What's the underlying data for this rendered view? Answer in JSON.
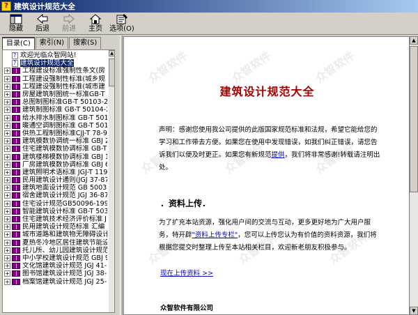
{
  "window": {
    "title": "建筑设计规范大全"
  },
  "toolbar": {
    "buttons": [
      {
        "label": "隐藏",
        "icon": "hide-icon",
        "enabled": true
      },
      {
        "label": "后退",
        "icon": "back-arrow-icon",
        "enabled": true
      },
      {
        "label": "前进",
        "icon": "forward-arrow-icon",
        "enabled": false
      },
      {
        "label": "主页",
        "icon": "home-icon",
        "enabled": true
      },
      {
        "label": "选项(O)",
        "icon": "options-icon",
        "enabled": true
      }
    ]
  },
  "tabs": [
    {
      "label": "目录(C)",
      "active": true
    },
    {
      "label": "索引(N)",
      "active": false
    },
    {
      "label": "搜索(S)",
      "active": false
    }
  ],
  "tree": {
    "items": [
      {
        "label": "欢迎光临众智网站!",
        "type": "page",
        "expander": "",
        "selected": false
      },
      {
        "label": "建筑设计规范大全",
        "type": "page",
        "expander": "",
        "selected": true
      },
      {
        "label": "工程建设标准强制性条文(房",
        "type": "book",
        "expander": "+",
        "selected": false
      },
      {
        "label": "工程建设强制性标准(城乡规",
        "type": "book",
        "expander": "+",
        "selected": false
      },
      {
        "label": "工程建设强制性标准(城市建",
        "type": "book",
        "expander": "+",
        "selected": false
      },
      {
        "label": "房屋建筑制图统一标准GB-T 5",
        "type": "book",
        "expander": "+",
        "selected": false
      },
      {
        "label": "总图制图标准GB-T 50103-200",
        "type": "book",
        "expander": "+",
        "selected": false
      },
      {
        "label": "建筑制图标准 GB-T 50104-200",
        "type": "book",
        "expander": "+",
        "selected": false
      },
      {
        "label": "给水排水制图标准 GB-T 50106",
        "type": "book",
        "expander": "+",
        "selected": false
      },
      {
        "label": "暖通空调制图标准 GB-T 50114",
        "type": "book",
        "expander": "+",
        "selected": false
      },
      {
        "label": "供热工程制图标准CJJ-T 78-9",
        "type": "book",
        "expander": "+",
        "selected": false
      },
      {
        "label": "建筑模数协调统一标准 GBJ 2",
        "type": "book",
        "expander": "+",
        "selected": false
      },
      {
        "label": "住宅建筑模数协调标准 GB-T",
        "type": "book",
        "expander": "+",
        "selected": false
      },
      {
        "label": "建筑楼梯模数协调标准 GBJ 1",
        "type": "book",
        "expander": "+",
        "selected": false
      },
      {
        "label": "厂房建筑模数协调标准 GBJ 6",
        "type": "book",
        "expander": "+",
        "selected": false
      },
      {
        "label": "建筑照明术语标准 JGJ-T 119-",
        "type": "book",
        "expander": "+",
        "selected": false
      },
      {
        "label": "民用建筑设计通则(JGJ 37-87",
        "type": "book",
        "expander": "+",
        "selected": false
      },
      {
        "label": "建筑地面设计规范 GB 50037-9",
        "type": "book",
        "expander": "+",
        "selected": false
      },
      {
        "label": "宿舍建筑设计规范 JGJ 36-87",
        "type": "book",
        "expander": "+",
        "selected": false
      },
      {
        "label": "住宅设计规范GB50096-1999(2",
        "type": "book",
        "expander": "+",
        "selected": false
      },
      {
        "label": "智能建筑设计标准 GB-T 50314",
        "type": "book",
        "expander": "+",
        "selected": false
      },
      {
        "label": "住宅建筑技术经济评价标准 J",
        "type": "book",
        "expander": "+",
        "selected": false
      },
      {
        "label": "民用建筑设计规范标准 汇编",
        "type": "book",
        "expander": "+",
        "selected": false
      },
      {
        "label": "城市道路和建筑物无障碍设计",
        "type": "book",
        "expander": "+",
        "selected": false
      },
      {
        "label": "夏热冬冷地区居住建筑节能设",
        "type": "book",
        "expander": "+",
        "selected": false
      },
      {
        "label": "托儿所、幼儿园建筑设计规范",
        "type": "book",
        "expander": "+",
        "selected": false
      },
      {
        "label": "中小学校建筑设计规范 GBJ 99",
        "type": "book",
        "expander": "+",
        "selected": false
      },
      {
        "label": "文化馆建筑设计规范 JGJ 41-",
        "type": "book",
        "expander": "+",
        "selected": false
      },
      {
        "label": "图书馆建筑设计规范 JGJ 38-9",
        "type": "book",
        "expander": "+",
        "selected": false
      },
      {
        "label": "档案馆建筑设计规范 JGJ 25-",
        "type": "book",
        "expander": "+",
        "selected": false
      }
    ]
  },
  "document": {
    "title": "建筑设计规范大全",
    "statement": {
      "text_before": "声明：感谢您使用我公司提供的此版国家规范标准和法规，希望它能给您的学习和工作带去方便。如果您在使用中发现错误，如我们纠正错误，请您告诉我们以便及时更正。如果您有新规范",
      "link": "提供",
      "text_after": "，我们将非常感谢!转载请注明出处。"
    },
    "section_heading": "．资料上传．",
    "upload": {
      "text_before": "为了扩充本站资源，强化用户间的交流与互动，更多更好地为广大用户服务，特开辟",
      "link": "\"资料上传专栏\"",
      "text_after": "，您可以上传您认为有价值的资料资源，我们将根据您提交时整理上传至本站相关栏目，欢迎新老朋友积极参与。"
    },
    "more_link": "现在上传资料 >>",
    "company": "众智软件有限公司",
    "watermark_text": "众智软件"
  }
}
